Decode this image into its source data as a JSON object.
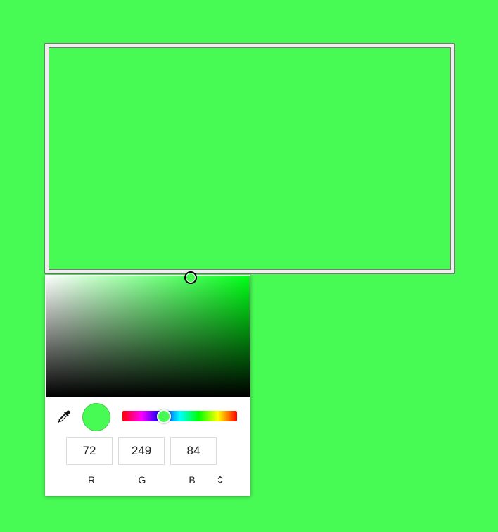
{
  "page": {
    "background_color": "#48fa54"
  },
  "color_input": {
    "value_color": "#48fa54",
    "button_face_color": "#efefef"
  },
  "picker": {
    "base_hue_color": "#00ff16",
    "preview_color": "#48fa54",
    "saturation_value": {
      "saturation_fraction": 0.71,
      "value_fraction": 0.98
    },
    "hue_fraction": 0.36,
    "channels": {
      "r": {
        "value": "72",
        "label": "R"
      },
      "g": {
        "value": "249",
        "label": "G"
      },
      "b": {
        "value": "84",
        "label": "B"
      }
    },
    "icons": {
      "eyedropper": "eyedropper-icon",
      "format_toggle": "up-down-chevron-icon"
    }
  }
}
